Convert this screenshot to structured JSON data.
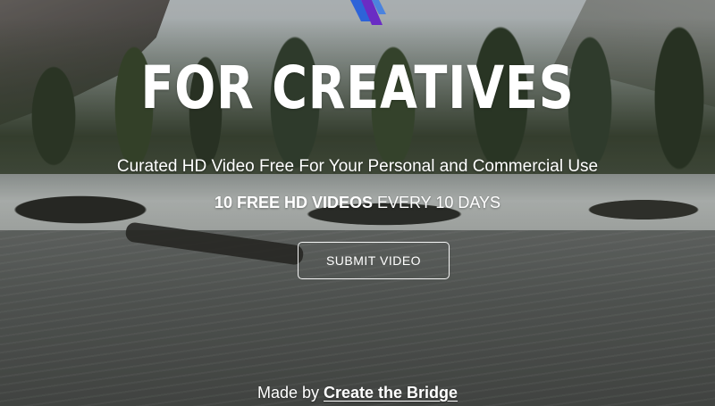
{
  "hero": {
    "headline": "FOR CREATIVES",
    "subheadline": "Curated HD Video Free For Your Personal and Commercial Use",
    "tagline_strong": "10 FREE HD VIDEOS",
    "tagline_light": " EVERY 10 DAYS",
    "submit_label": "SUBMIT VIDEO"
  },
  "footer": {
    "made_by": "Made by ",
    "brand_link": "Create the Bridge"
  },
  "colors": {
    "text": "#ffffff",
    "logo_blue": "#2d63d8",
    "logo_purple": "#6a2cc4"
  },
  "icons": {
    "logo": "brand-logo-icon"
  }
}
